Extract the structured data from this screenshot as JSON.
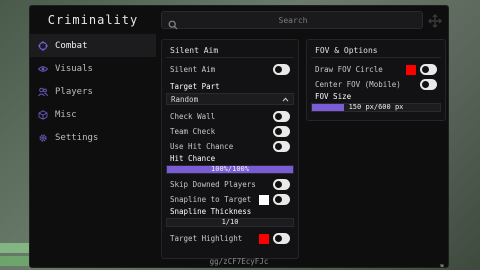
{
  "window": {
    "title": "Criminality",
    "footer_link": "gg/zCF7EcyFJc"
  },
  "search": {
    "placeholder": "Search"
  },
  "sidebar": {
    "items": [
      {
        "label": "Combat",
        "icon": "crosshair-icon",
        "active": true
      },
      {
        "label": "Visuals",
        "icon": "eye-icon",
        "active": false
      },
      {
        "label": "Players",
        "icon": "users-icon",
        "active": false
      },
      {
        "label": "Misc",
        "icon": "cube-icon",
        "active": false
      },
      {
        "label": "Settings",
        "icon": "gear-icon",
        "active": false
      }
    ]
  },
  "silent_aim": {
    "title": "Silent Aim",
    "enabled_label": "Silent Aim",
    "target_part": {
      "label": "Target Part",
      "value": "Random"
    },
    "check_wall": "Check Wall",
    "team_check": "Team Check",
    "use_hit_chance": "Use Hit Chance",
    "hit_chance": {
      "label": "Hit Chance",
      "value_text": "100%/100%",
      "fraction": 1.0
    },
    "skip_downed": "Skip Downed Players",
    "snapline": {
      "label": "Snapline to Target",
      "color": "#ffffff"
    },
    "snapline_thickness": {
      "label": "Snapline Thickness",
      "value_text": "1/10",
      "fraction": 0.1
    },
    "target_highlight": {
      "label": "Target Highlight",
      "color": "#ff0000"
    }
  },
  "fov": {
    "title": "FOV & Options",
    "draw_circle": {
      "label": "Draw FOV Circle",
      "color": "#ff0000"
    },
    "center_fov": "Center FOV (Mobile)",
    "fov_size": {
      "label": "FOV Size",
      "value_text": "150 px/600 px",
      "fraction": 0.25
    }
  },
  "colors": {
    "accent": "#7a5cd6",
    "background": "#0e0e0f"
  }
}
